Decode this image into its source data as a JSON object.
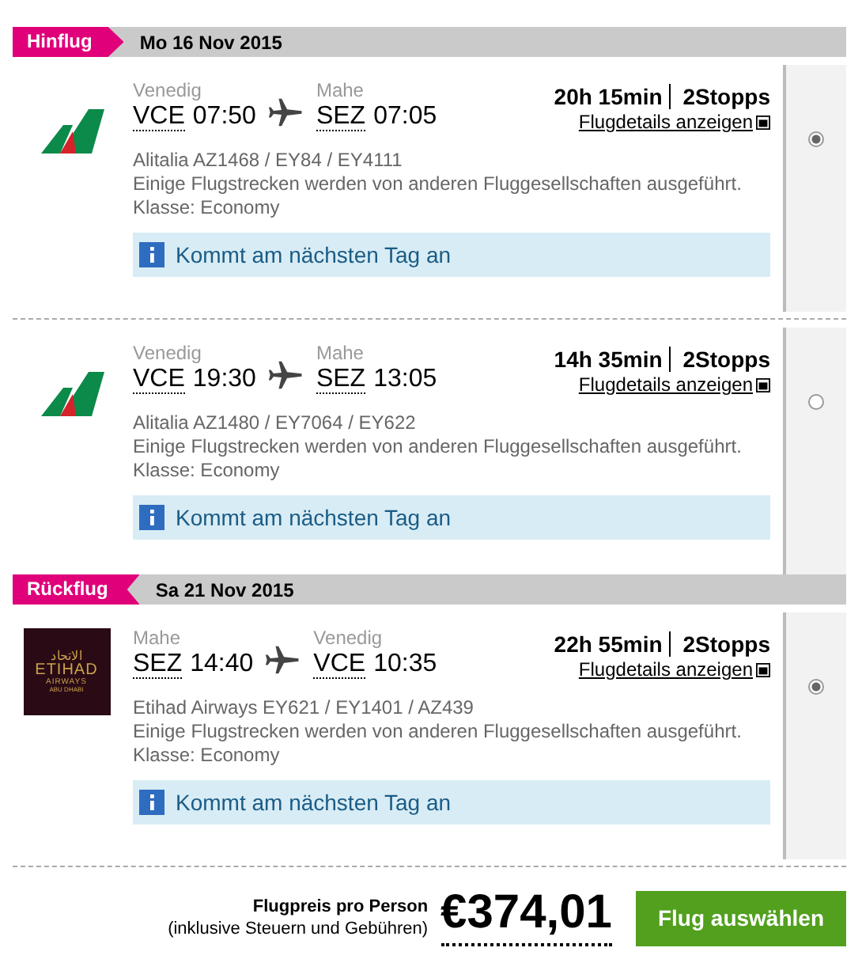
{
  "sections": [
    {
      "label": "Hinflug",
      "kind": "outbound",
      "date": "Mo 16 Nov 2015",
      "flights": [
        {
          "logo": {
            "kind": "stripes"
          },
          "from": {
            "city": "Venedig",
            "code": "VCE",
            "time": "07:50"
          },
          "to": {
            "city": "Mahe",
            "code": "SEZ",
            "time": "07:05"
          },
          "duration": "20h 15min",
          "stops": "2Stopps",
          "details_link": "Flugdetails anzeigen",
          "info_lines": [
            "Alitalia AZ1468 / EY84 / EY4111",
            "Einige Flugstrecken werden von anderen Fluggesellschaften ausgeführt.",
            "Klasse: Economy"
          ],
          "note": "Kommt am nächsten Tag an",
          "selected": true
        },
        {
          "logo": {
            "kind": "stripes"
          },
          "from": {
            "city": "Venedig",
            "code": "VCE",
            "time": "19:30"
          },
          "to": {
            "city": "Mahe",
            "code": "SEZ",
            "time": "13:05"
          },
          "duration": "14h 35min",
          "stops": "2Stopps",
          "details_link": "Flugdetails anzeigen",
          "info_lines": [
            "Alitalia AZ1480 / EY7064 / EY622",
            "Einige Flugstrecken werden von anderen Fluggesellschaften ausgeführt.",
            "Klasse: Economy"
          ],
          "note": "Kommt am nächsten Tag an",
          "selected": false
        }
      ]
    },
    {
      "label": "Rückflug",
      "kind": "return",
      "date": "Sa 21 Nov 2015",
      "flights": [
        {
          "logo": {
            "kind": "badge",
            "lines": [
              "الاتحاد",
              "ETIHAD",
              "AIRWAYS",
              "ABU DHABI"
            ]
          },
          "from": {
            "city": "Mahe",
            "code": "SEZ",
            "time": "14:40"
          },
          "to": {
            "city": "Venedig",
            "code": "VCE",
            "time": "10:35"
          },
          "duration": "22h 55min",
          "stops": "2Stopps",
          "details_link": "Flugdetails anzeigen",
          "info_lines": [
            "Etihad Airways EY621 / EY1401 / AZ439",
            "Einige Flugstrecken werden von anderen Fluggesellschaften ausgeführt.",
            "Klasse: Economy"
          ],
          "note": "Kommt am nächsten Tag an",
          "selected": true
        }
      ]
    }
  ],
  "footer": {
    "price_label": "Flugpreis pro Person",
    "price_note": "(inklusive Steuern und Gebühren)",
    "price": "€374,01",
    "button": "Flug auswählen"
  }
}
